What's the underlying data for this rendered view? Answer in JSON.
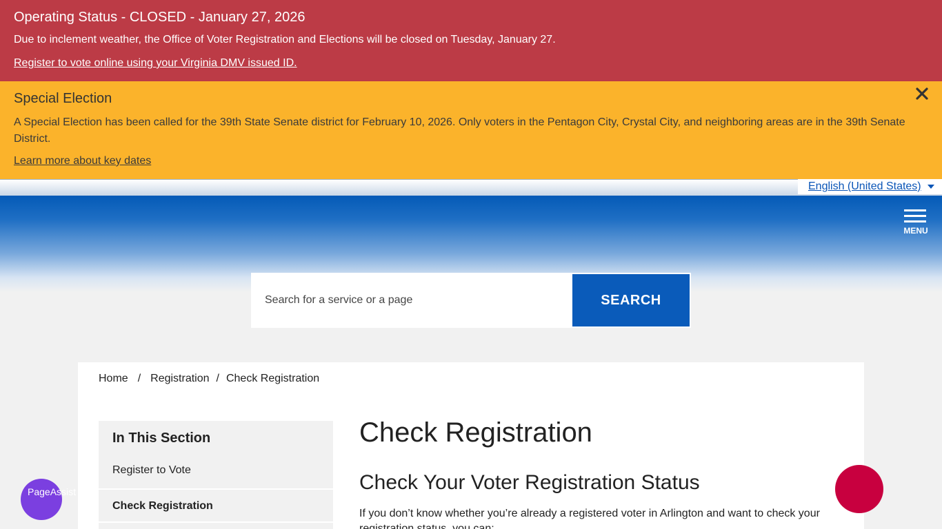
{
  "alerts": {
    "operating": {
      "title": "Operating Status - CLOSED - January 27, 2026",
      "text": "Due to inclement weather, the Office of Voter Registration and Elections will be closed on Tuesday, January 27.",
      "link": "Register to vote online using your Virginia DMV issued ID."
    },
    "special": {
      "title": "Special Election",
      "text": "A Special Election has been called for the 39th State Senate district for February 10, 2026. Only voters in the Pentagon City, Crystal City, and neighboring areas are in the 39th Senate District.",
      "link": "Learn more about key dates"
    }
  },
  "language": {
    "selected": "English (United States)"
  },
  "header": {
    "menu_label": "MENU"
  },
  "search": {
    "placeholder": "Search for a service or a page",
    "button_label": "SEARCH"
  },
  "breadcrumb": [
    "Home",
    "Registration",
    "Check Registration"
  ],
  "sidebar": {
    "title": "In This Section",
    "items": [
      {
        "label": "Register to Vote",
        "active": false
      },
      {
        "label": "Check Registration",
        "active": true
      }
    ]
  },
  "main": {
    "title": "Check Registration",
    "subtitle": "Check Your Voter Registration Status",
    "body": "If you don’t know whether you’re already a registered voter in Arlington and want to check your registration status, you can:"
  },
  "widgets": {
    "page_assist_alt": "PageAssist Personalization Options"
  },
  "colors": {
    "alert_red": "#bc3b46",
    "alert_yellow": "#fbb32b",
    "brand_blue": "#0a5bba",
    "chat_red": "#c8003f",
    "assist_purple": "#7b3fe0"
  }
}
